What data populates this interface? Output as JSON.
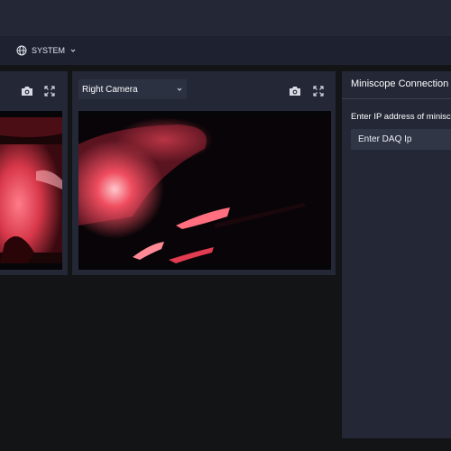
{
  "nav": {
    "system_label": "SYSTEM",
    "system_icon": "globe-icon",
    "dropdown_icon": "chevron-down-icon"
  },
  "cameras": {
    "left": {
      "icons": [
        "camera-icon",
        "expand-icon"
      ]
    },
    "right": {
      "selected": "Right Camera",
      "icons": [
        "camera-icon",
        "expand-icon"
      ]
    }
  },
  "connection": {
    "title": "Miniscope Connection",
    "ip_label": "Enter IP address of miniscope",
    "ip_value": "",
    "ip_placeholder": "Enter DAQ Ip"
  },
  "colors": {
    "background": "#131416",
    "header": "#232736",
    "subheader": "#1d2130",
    "panel": "#232736",
    "input": "#313647",
    "feed_glow": "#ff4d61"
  }
}
